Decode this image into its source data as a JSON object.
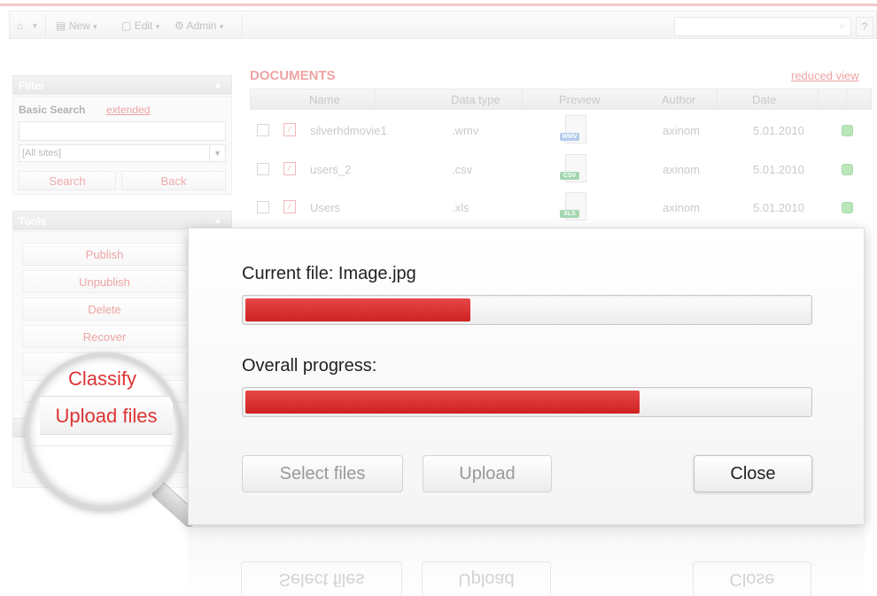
{
  "toolbar": {
    "home_caret": "▾",
    "new_label": "New",
    "edit_label": "Edit",
    "admin_label": "Admin",
    "help_label": "?"
  },
  "filter": {
    "title": "Filter",
    "basic_search_label": "Basic Search",
    "extended_link": "extended",
    "search_value": "",
    "site_select_value": "[All sites]",
    "search_button": "Search",
    "back_button": "Back"
  },
  "tools": {
    "title": "Tools",
    "buttons": [
      "Publish",
      "Unpublish",
      "Delete",
      "Recover"
    ]
  },
  "documents": {
    "title": "DOCUMENTS",
    "reduced_view_link": "reduced view",
    "columns": [
      "Name",
      "Data type",
      "Preview",
      "Author",
      "Date"
    ],
    "rows": [
      {
        "name": "silverhdmovie1",
        "type": ".wmv",
        "tag": "WMV",
        "tag_color": "#5b8fd6",
        "author": "axinom",
        "date": "5.01.2010"
      },
      {
        "name": "users_2",
        "type": ".csv",
        "tag": "CSV",
        "tag_color": "#3aa655",
        "author": "axinom",
        "date": "5.01.2010"
      },
      {
        "name": "Users",
        "type": ".xls",
        "tag": "XLS",
        "tag_color": "#3aa655",
        "author": "axinom",
        "date": "5.01.2010"
      }
    ]
  },
  "magnifier": {
    "classify_label": "Classify",
    "upload_label": "Upload files"
  },
  "dialog": {
    "current_file_label": "Current file:  Image.jpg",
    "current_progress_percent": 40,
    "overall_label": "Overall progress:",
    "overall_progress_percent": 70,
    "select_files_button": "Select files",
    "upload_button": "Upload",
    "close_button": "Close"
  },
  "colors": {
    "accent": "#d33333",
    "progress_fill": "#d82a2a"
  }
}
